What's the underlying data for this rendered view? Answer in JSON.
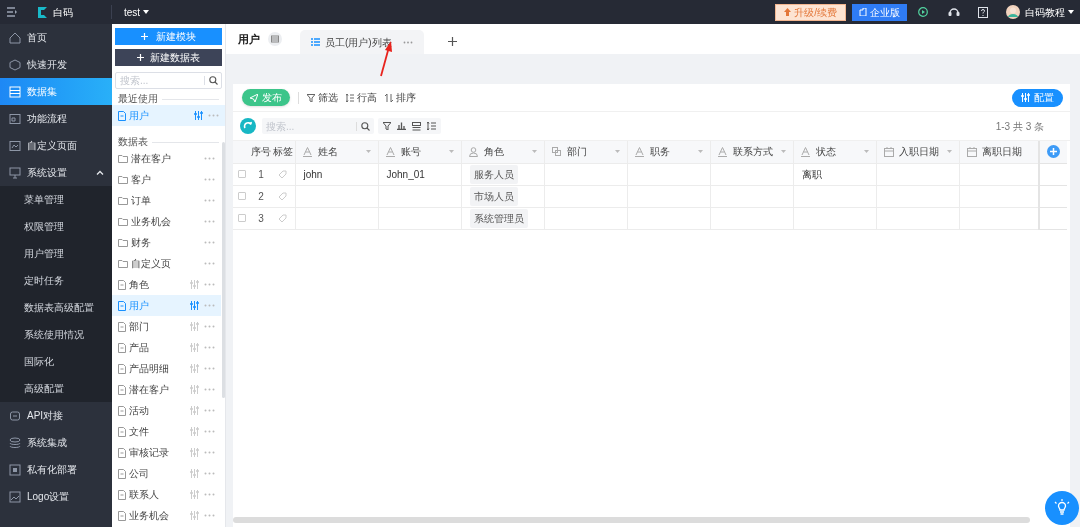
{
  "top_bar": {
    "logo": "白码",
    "project": "test",
    "upgrade_button": "升级/续费",
    "edition_button": "企业版",
    "user_name": "白码教程"
  },
  "nav": {
    "items": [
      {
        "label": "首页",
        "selected": false
      },
      {
        "label": "快速开发",
        "selected": false
      },
      {
        "label": "数据集",
        "selected": true
      },
      {
        "label": "功能流程",
        "selected": false
      },
      {
        "label": "自定义页面",
        "selected": false
      },
      {
        "label": "系统设置",
        "selected": false,
        "expanded": true,
        "children": [
          {
            "label": "菜单管理",
            "selected": false
          },
          {
            "label": "权限管理",
            "selected": false
          },
          {
            "label": "用户管理",
            "selected": false
          },
          {
            "label": "定时任务",
            "selected": false
          },
          {
            "label": "数据表高级配置",
            "selected": false
          },
          {
            "label": "系统使用情况",
            "selected": false
          },
          {
            "label": "国际化",
            "selected": false
          },
          {
            "label": "高级配置",
            "selected": false
          }
        ]
      },
      {
        "label": "API对接",
        "selected": false
      },
      {
        "label": "系统集成",
        "selected": false
      },
      {
        "label": "私有化部署",
        "selected": false
      },
      {
        "label": "Logo设置",
        "selected": false
      }
    ]
  },
  "panel": {
    "new_module_button": "新建模块",
    "new_table_button": "新建数据表",
    "search_placeholder": "搜索...",
    "recent_label": "最近使用",
    "recent": [
      {
        "label": "用户",
        "kind": "table",
        "selected": true
      }
    ],
    "tables_label": "数据表",
    "tables": [
      {
        "label": "潜在客户",
        "kind": "folder",
        "selected": false
      },
      {
        "label": "客户",
        "kind": "folder",
        "selected": false
      },
      {
        "label": "订单",
        "kind": "folder",
        "selected": false
      },
      {
        "label": "业务机会",
        "kind": "folder",
        "selected": false
      },
      {
        "label": "财务",
        "kind": "folder",
        "selected": false
      },
      {
        "label": "自定义页",
        "kind": "folder",
        "selected": false
      },
      {
        "label": "角色",
        "kind": "table",
        "selected": false
      },
      {
        "label": "用户",
        "kind": "table",
        "selected": true
      },
      {
        "label": "部门",
        "kind": "table",
        "selected": false
      },
      {
        "label": "产品",
        "kind": "table",
        "selected": false
      },
      {
        "label": "产品明细",
        "kind": "table",
        "selected": false
      },
      {
        "label": "潜在客户",
        "kind": "table",
        "selected": false
      },
      {
        "label": "活动",
        "kind": "table",
        "selected": false
      },
      {
        "label": "文件",
        "kind": "table",
        "selected": false
      },
      {
        "label": "审核记录",
        "kind": "table",
        "selected": false
      },
      {
        "label": "公司",
        "kind": "table",
        "selected": false
      },
      {
        "label": "联系人",
        "kind": "table",
        "selected": false
      },
      {
        "label": "业务机会",
        "kind": "table",
        "selected": false
      }
    ]
  },
  "main": {
    "title": "用户",
    "tabs": [
      {
        "label": "员工(用户)列表",
        "selected": true
      }
    ],
    "toolbar": {
      "publish_button": "发布",
      "filter_button": "筛选",
      "row_height_button": "行高",
      "sort_button": "排序",
      "config_button": "配置"
    },
    "search_placeholder": "搜索...",
    "pagination": "1-3 共 3 条",
    "table": {
      "index_column": "序号",
      "tag_column": "标签",
      "columns": [
        {
          "label": "姓名",
          "kind": "text"
        },
        {
          "label": "账号",
          "kind": "text"
        },
        {
          "label": "角色",
          "kind": "user"
        },
        {
          "label": "部门",
          "kind": "dept"
        },
        {
          "label": "职务",
          "kind": "text"
        },
        {
          "label": "联系方式",
          "kind": "text"
        },
        {
          "label": "状态",
          "kind": "text"
        },
        {
          "label": "入职日期",
          "kind": "date"
        },
        {
          "label": "离职日期",
          "kind": "date"
        }
      ],
      "rows": [
        {
          "checked": false,
          "index": "1",
          "cells": [
            "john",
            "John_01",
            "服务人员",
            null,
            null,
            null,
            "离职",
            null,
            null
          ]
        },
        {
          "checked": false,
          "index": "2",
          "cells": [
            null,
            null,
            "市场人员",
            null,
            null,
            null,
            null,
            null,
            null
          ]
        },
        {
          "checked": false,
          "index": "3",
          "cells": [
            null,
            null,
            "系统管理员",
            null,
            null,
            null,
            null,
            null,
            null
          ]
        }
      ]
    }
  }
}
